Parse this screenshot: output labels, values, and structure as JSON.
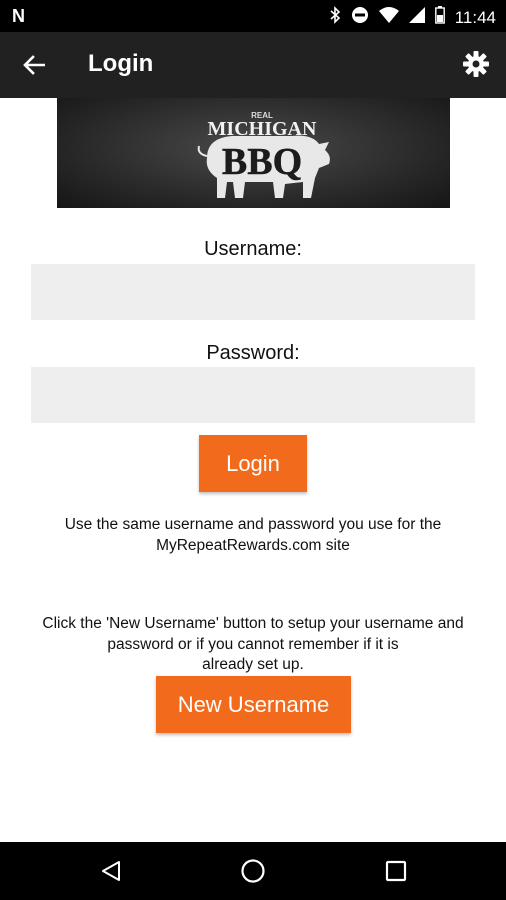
{
  "status_bar": {
    "time": "11:44",
    "left_icon": "N",
    "icons": [
      "bluetooth-icon",
      "do-not-disturb-icon",
      "wifi-icon",
      "signal-icon",
      "battery-icon"
    ]
  },
  "app_bar": {
    "title": "Login",
    "back_icon": "arrow-left-icon",
    "settings_icon": "gear-icon"
  },
  "banner": {
    "small_text": "REAL",
    "line1": "MICHIGAN",
    "line2": "BBQ"
  },
  "form": {
    "username_label": "Username:",
    "username_value": "",
    "password_label": "Password:",
    "password_value": "",
    "login_button": "Login"
  },
  "notes": {
    "same_credentials_line1": "Use the same username and password you use for the",
    "same_credentials_line2": "MyRepeatRewards.com site",
    "new_user_line1": "Click the 'New Username' button to setup your username and",
    "new_user_line2": "password or if you cannot remember if it is",
    "new_user_line3": "already set up."
  },
  "new_username_button": "New Username",
  "nav_bar": {
    "icons": [
      "back-triangle-icon",
      "home-circle-icon",
      "recents-square-icon"
    ]
  },
  "colors": {
    "accent": "#f26b1d",
    "app_bar": "#212121",
    "field_bg": "#eeeeee"
  }
}
